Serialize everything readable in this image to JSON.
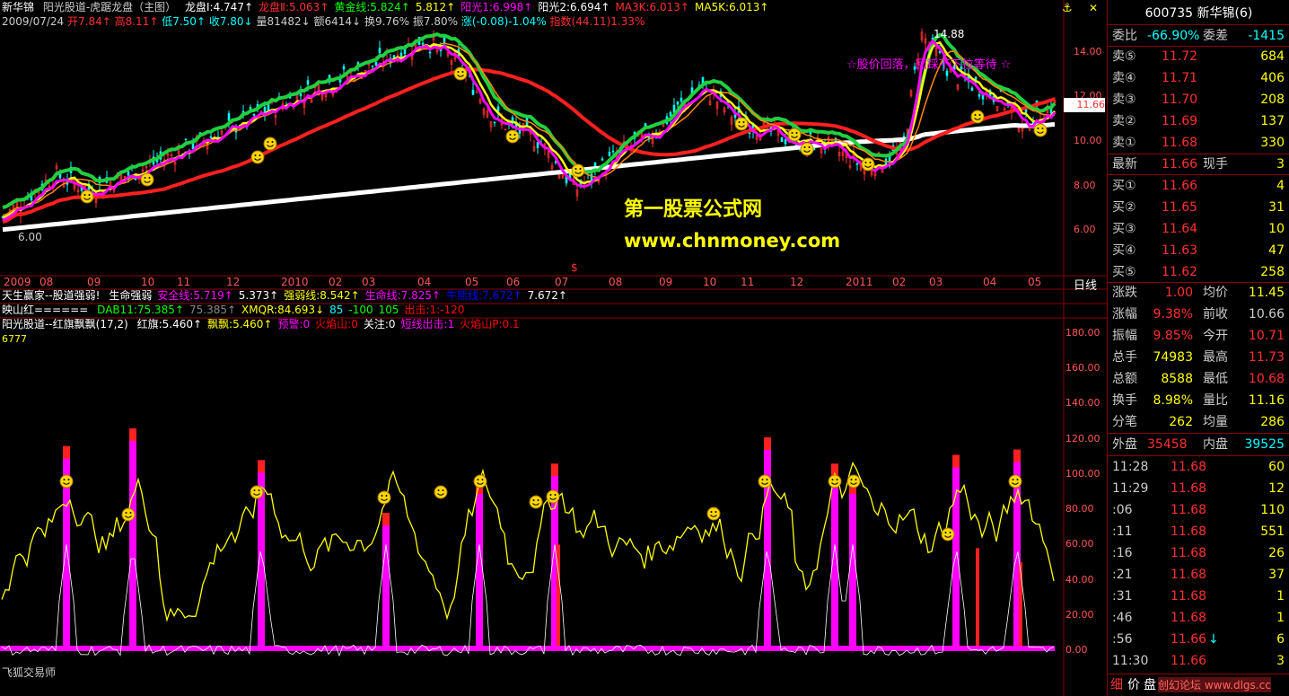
{
  "stock": {
    "name": "新华锦",
    "code": "600735",
    "code_label": "600735 新华锦(6)"
  },
  "main_panel": {
    "title": "阳光股道-虎踞龙盘（主图）",
    "indicators": [
      {
        "label": "龙盘Ⅰ:4.747↑",
        "color": "#ffffff"
      },
      {
        "label": "龙盘Ⅱ:5.063↑",
        "color": "#ff3030"
      },
      {
        "label": "黄金线:5.824↑",
        "color": "#00ff00"
      },
      {
        "label": "5.812↑",
        "color": "#ffff00"
      },
      {
        "label": "阳光1:6.998↑",
        "color": "#ff00ff"
      },
      {
        "label": "阳光2:6.694↑",
        "color": "#ffffff"
      },
      {
        "label": "MA3K:6.013↑",
        "color": "#ff3030"
      },
      {
        "label": "MA5K:6.013↑",
        "color": "#ffff00"
      }
    ],
    "bar_info": {
      "date": "2009/07/24",
      "open": "开7.84↑",
      "high": "高8.11↑",
      "low": "低7.50↑",
      "close": "收7.80↓",
      "volume": "量81482↓",
      "amount": "额6414↓",
      "turnover": "换9.76%",
      "amplitude": "振7.80%",
      "change": "涨(-0.08)-1.04%",
      "index": "指数(44.11)1.33%"
    },
    "peak_label": "14.88",
    "trough_label": "6.00",
    "annotation": "☆股价回落，回踩不下拉等待 ☆",
    "watermark_title": "第一股票公式网",
    "watermark_url": "www.chnmoney.com",
    "y_ticks": [
      "14.00",
      "12.00",
      "10.00",
      "8.00",
      "6.00"
    ],
    "price_tag": "11.66",
    "x_ticks": [
      "2009",
      "08",
      "09",
      "10",
      "11",
      "12",
      "2010",
      "02",
      "03",
      "04",
      "05",
      "06",
      "07",
      "08",
      "09",
      "10",
      "11",
      "12",
      "2011",
      "02",
      "03",
      "04",
      "05"
    ],
    "period": "日线"
  },
  "sub1": {
    "title": "天生赢家--股道强弱!",
    "items": [
      {
        "label": "生命强弱",
        "color": "#ffffff"
      },
      {
        "label": "安全线:5.719↑",
        "color": "#ff00ff"
      },
      {
        "label": "5.373↑",
        "color": "#ffffff"
      },
      {
        "label": "强弱线:8.542↑",
        "color": "#ffff00"
      },
      {
        "label": "生命线:7.825↑",
        "color": "#ff00ff"
      },
      {
        "label": "牛熊线:7.672↑",
        "color": "#0000ff"
      },
      {
        "label": "7.672↑",
        "color": "#ffffff"
      }
    ]
  },
  "sub2": {
    "title": "映山红======",
    "items": [
      {
        "label": "DAB11:75.385↑",
        "color": "#00ff00"
      },
      {
        "label": "75.385↑",
        "color": "#888888"
      },
      {
        "label": "XMQR:84.693↓",
        "color": "#ffff00"
      },
      {
        "label": "85",
        "color": "#00ffff"
      },
      {
        "label": "-100",
        "color": "#00ff00"
      },
      {
        "label": "105",
        "color": "#00ff00"
      },
      {
        "label": "出击:1:-120",
        "color": "#ff0000"
      }
    ]
  },
  "sub3": {
    "title": "阳光股道--红旗飘飘(17,2)",
    "items": [
      {
        "label": "红旗:5.460↑",
        "color": "#ffffff"
      },
      {
        "label": "飘飘:5.460↑",
        "color": "#ffff00"
      },
      {
        "label": "预警:0",
        "color": "#ff00ff"
      },
      {
        "label": "火焰山:0",
        "color": "#ff0000"
      },
      {
        "label": "关注:0",
        "color": "#ffffff"
      },
      {
        "label": "短线出击:1",
        "color": "#ff00ff"
      },
      {
        "label": "火焰山P:0.1",
        "color": "#ff0000"
      }
    ],
    "corner_value": "6777",
    "y_ticks": [
      "180.00",
      "160.00",
      "140.00",
      "120.00",
      "100.00",
      "80.00",
      "60.00",
      "40.00",
      "20.00",
      "0.00"
    ],
    "footer_label": "飞狐交易师"
  },
  "quote_panel": {
    "weibi": {
      "label": "委比",
      "value": "-66.90%",
      "label2": "委差",
      "value2": "-1415"
    },
    "sell": [
      {
        "label": "卖⑤",
        "price": "11.72",
        "vol": "684"
      },
      {
        "label": "卖④",
        "price": "11.71",
        "vol": "406"
      },
      {
        "label": "卖③",
        "price": "11.70",
        "vol": "208"
      },
      {
        "label": "卖②",
        "price": "11.69",
        "vol": "137"
      },
      {
        "label": "卖①",
        "price": "11.68",
        "vol": "330"
      }
    ],
    "latest": {
      "label": "最新",
      "price": "11.66",
      "label2": "现手",
      "vol": "3"
    },
    "buy": [
      {
        "label": "买①",
        "price": "11.66",
        "vol": "4"
      },
      {
        "label": "买②",
        "price": "11.65",
        "vol": "31"
      },
      {
        "label": "买③",
        "price": "11.64",
        "vol": "10"
      },
      {
        "label": "买④",
        "price": "11.63",
        "vol": "47"
      },
      {
        "label": "买⑤",
        "price": "11.62",
        "vol": "258"
      }
    ],
    "stats": [
      {
        "l1": "涨跌",
        "v1": "1.00",
        "l2": "均价",
        "v2": "11.45"
      },
      {
        "l1": "涨幅",
        "v1": "9.38%",
        "l2": "前收",
        "v2": "10.66"
      },
      {
        "l1": "振幅",
        "v1": "9.85%",
        "l2": "今开",
        "v2": "10.71"
      },
      {
        "l1": "总手",
        "v1": "74983",
        "l2": "最高",
        "v2": "11.73"
      },
      {
        "l1": "总额",
        "v1": "8588",
        "l2": "最低",
        "v2": "10.68"
      },
      {
        "l1": "换手",
        "v1": "8.98%",
        "l2": "量比",
        "v2": "11.16"
      },
      {
        "l1": "分笔",
        "v1": "262",
        "l2": "均量",
        "v2": "286"
      }
    ],
    "outer": {
      "l1": "外盘",
      "v1": "35458",
      "l2": "内盘",
      "v2": "39525"
    },
    "ticks": [
      {
        "time": "11:28",
        "price": "11.68",
        "vol": "60",
        "arrow": ""
      },
      {
        "time": "11:29",
        "price": "11.68",
        "vol": "12",
        "arrow": ""
      },
      {
        "time": ":06",
        "price": "11.68",
        "vol": "110",
        "arrow": ""
      },
      {
        "time": ":11",
        "price": "11.68",
        "vol": "551",
        "arrow": ""
      },
      {
        "time": ":16",
        "price": "11.68",
        "vol": "26",
        "arrow": ""
      },
      {
        "time": ":21",
        "price": "11.68",
        "vol": "37",
        "arrow": ""
      },
      {
        "time": ":31",
        "price": "11.68",
        "vol": "1",
        "arrow": ""
      },
      {
        "time": ":46",
        "price": "11.68",
        "vol": "1",
        "arrow": ""
      },
      {
        "time": ":56",
        "price": "11.66",
        "vol": "6",
        "arrow": "↓"
      },
      {
        "time": "11:30",
        "price": "11.66",
        "vol": "3",
        "arrow": ""
      }
    ],
    "bottom_tabs": [
      "细",
      "价",
      "盘"
    ],
    "watermark": "创幻论坛 www.dlgs.cc"
  },
  "colors": {
    "up": "#ff3030",
    "down": "#00ffff",
    "axis": "#8b0000",
    "label": "#ff5555"
  }
}
